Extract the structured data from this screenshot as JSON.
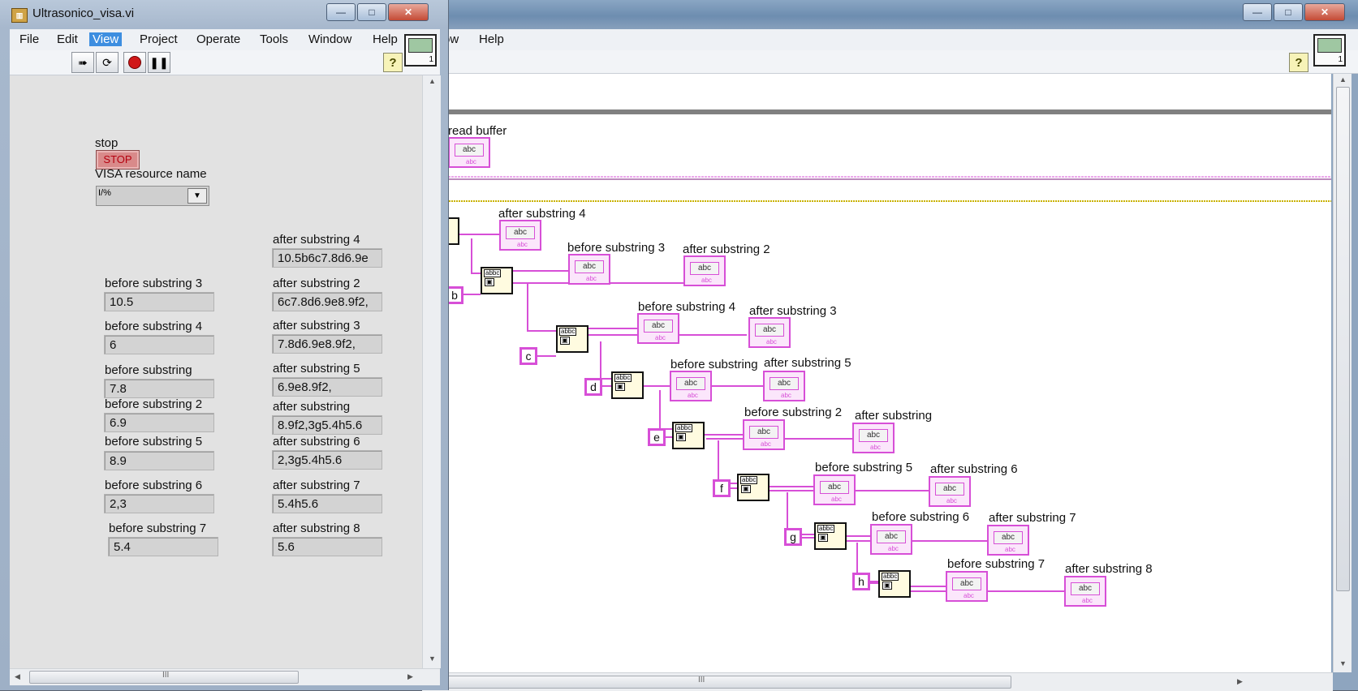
{
  "front_panel": {
    "window_title": "Ultrasonico_visa.vi",
    "menu": [
      "File",
      "Edit",
      "View",
      "Project",
      "Operate",
      "Tools",
      "Window",
      "Help"
    ],
    "active_menu": "View",
    "toolbar": {
      "run_icon": "run-arrow-icon",
      "run_continuous_icon": "run-continuously-icon",
      "abort_icon": "abort-icon",
      "pause_icon": "pause-icon",
      "help_icon": "context-help-icon",
      "help_glyph": "?"
    },
    "vi_icon_number": "1",
    "stop_control": {
      "label": "stop",
      "button_text": "STOP"
    },
    "visa_control": {
      "label": "VISA resource name",
      "value": "",
      "icon_glyph": "I/%"
    },
    "indicators": {
      "before_substring_3": {
        "label": "before substring 3",
        "value": "10.5"
      },
      "before_substring_4": {
        "label": "before substring 4",
        "value": "6"
      },
      "before_substring": {
        "label": "before substring",
        "value": "7.8"
      },
      "before_substring_2": {
        "label": "before substring 2",
        "value": "6.9"
      },
      "before_substring_5": {
        "label": "before substring 5",
        "value": "8.9"
      },
      "before_substring_6": {
        "label": "before substring 6",
        "value": "2,3"
      },
      "before_substring_7": {
        "label": "before substring 7",
        "value": "5.4"
      },
      "after_substring_4": {
        "label": "after substring 4",
        "value": "10.5b6c7.8d6.9e"
      },
      "after_substring_2": {
        "label": "after substring 2",
        "value": "6c7.8d6.9e8.9f2,"
      },
      "after_substring_3": {
        "label": "after substring 3",
        "value": "7.8d6.9e8.9f2,"
      },
      "after_substring_5": {
        "label": "after substring 5",
        "value": "6.9e8.9f2,"
      },
      "after_substring": {
        "label": "after substring",
        "value": "8.9f2,3g5.4h5.6"
      },
      "after_substring_6": {
        "label": "after substring 6",
        "value": "2,3g5.4h5.6"
      },
      "after_substring_7": {
        "label": "after substring 7",
        "value": "5.4h5.6"
      },
      "after_substring_8": {
        "label": "after substring 8",
        "value": "5.6"
      }
    },
    "hscroll_glyph": "III"
  },
  "block_diagram": {
    "menu": [
      "ow",
      "Help"
    ],
    "help_glyph": "?",
    "vi_icon_number": "1",
    "hscroll_glyph": "III",
    "terminal_text": "abc",
    "terminal_tag": "abc",
    "match_fn_top": "abbc",
    "match_fn_side": "bb",
    "terminals": {
      "read_buffer": "read buffer",
      "after_substring_4": "after substring 4",
      "before_substring_3": "before substring 3",
      "after_substring_2": "after substring 2",
      "before_substring_4": "before substring 4",
      "after_substring_3": "after substring 3",
      "before_substring": "before substring",
      "after_substring_5": "after substring 5",
      "before_substring_2": "before substring 2",
      "after_substring": "after substring",
      "before_substring_5": "before substring 5",
      "after_substring_6": "after substring 6",
      "before_substring_6": "before substring 6",
      "after_substring_7": "after substring 7",
      "before_substring_7": "before substring 7",
      "after_substring_8": "after substring 8"
    },
    "constants": [
      "b",
      "c",
      "d",
      "e",
      "f",
      "g",
      "h"
    ]
  },
  "colors": {
    "string_wire": "#d74fd7",
    "error_wire": "#c9b200",
    "reference_wire": "#7a1a7a",
    "stop_text": "#b4000f"
  }
}
